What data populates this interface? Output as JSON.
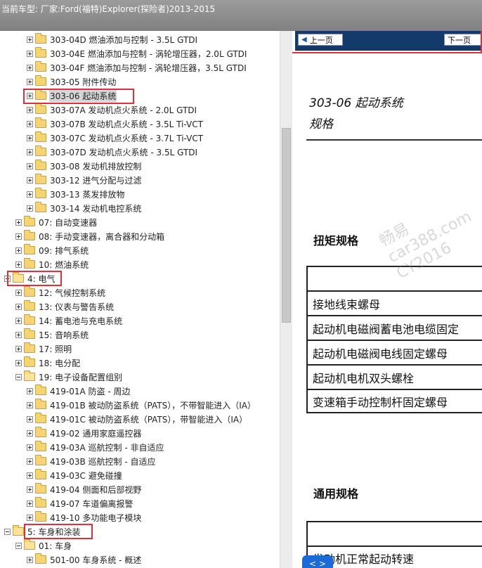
{
  "window": {
    "title": "当前车型:  厂家:Ford(福特)Explorer(探险者)2013-2015"
  },
  "tree": {
    "items": [
      {
        "label": "303-04D 燃油添加与控制 - 3.5L GTDI",
        "folder_open": false,
        "expand": "plus",
        "selected": false
      },
      {
        "label": "303-04E 燃油添加与控制 - 涡轮增压器，2.0L GTDI",
        "folder_open": false,
        "expand": "plus",
        "selected": false
      },
      {
        "label": "303-04F 燃油添加与控制 - 涡轮增压器，3.5L GTDI",
        "folder_open": false,
        "expand": "plus",
        "selected": false
      },
      {
        "label": "303-05 附件传动",
        "folder_open": false,
        "expand": "plus",
        "selected": false
      },
      {
        "label": "303-06 起动系统",
        "folder_open": false,
        "expand": "plus",
        "selected": true
      },
      {
        "label": "303-07A 发动机点火系统 - 2.0L GTDI",
        "folder_open": false,
        "expand": "plus",
        "selected": false
      },
      {
        "label": "303-07B 发动机点火系统 - 3.5L Ti-VCT",
        "folder_open": false,
        "expand": "plus",
        "selected": false
      },
      {
        "label": "303-07C 发动机点火系统 - 3.7L Ti-VCT",
        "folder_open": false,
        "expand": "plus",
        "selected": false
      },
      {
        "label": "303-07D 发动机点火系统 - 3.5L GTDI",
        "folder_open": false,
        "expand": "plus",
        "selected": false
      },
      {
        "label": "303-08 发动机排放控制",
        "folder_open": false,
        "expand": "plus",
        "selected": false
      },
      {
        "label": "303-12 进气分配与过滤",
        "folder_open": false,
        "expand": "plus",
        "selected": false
      },
      {
        "label": "303-13 蒸发排放物",
        "folder_open": false,
        "expand": "plus",
        "selected": false
      },
      {
        "label": "303-14 发动机电控系统",
        "folder_open": false,
        "expand": "plus",
        "selected": false
      },
      {
        "label": "07: 自动变速器",
        "folder_open": false,
        "expand": "plus",
        "selected": false
      },
      {
        "label": "08: 手动变速器，离合器和分动箱",
        "folder_open": false,
        "expand": "plus",
        "selected": false
      },
      {
        "label": "09: 排气系统",
        "folder_open": false,
        "expand": "plus",
        "selected": false
      },
      {
        "label": "10: 燃油系统",
        "folder_open": false,
        "expand": "plus",
        "selected": false
      },
      {
        "label": "4: 电气",
        "folder_open": true,
        "expand": "minus",
        "selected": false
      },
      {
        "label": "12: 气候控制系统",
        "folder_open": false,
        "expand": "plus",
        "selected": false
      },
      {
        "label": "13: 仪表与警告系统",
        "folder_open": false,
        "expand": "plus",
        "selected": false
      },
      {
        "label": "14: 蓄电池与充电系统",
        "folder_open": false,
        "expand": "plus",
        "selected": false
      },
      {
        "label": "15: 音响系统",
        "folder_open": false,
        "expand": "plus",
        "selected": false
      },
      {
        "label": "17: 照明",
        "folder_open": false,
        "expand": "plus",
        "selected": false
      },
      {
        "label": "18: 电分配",
        "folder_open": false,
        "expand": "plus",
        "selected": false
      },
      {
        "label": "19: 电子设备配置组别",
        "folder_open": true,
        "expand": "minus",
        "selected": false
      },
      {
        "label": "419-01A 防盗 - 周边",
        "folder_open": false,
        "expand": "plus",
        "selected": false
      },
      {
        "label": "419-01B 被动防盗系统（PATS），不带智能进入（IA）",
        "folder_open": false,
        "expand": "plus",
        "selected": false
      },
      {
        "label": "419-01C 被动防盗系统（PATS），带智能进入（IA）",
        "folder_open": false,
        "expand": "plus",
        "selected": false
      },
      {
        "label": "419-02 通用家庭遥控器",
        "folder_open": false,
        "expand": "plus",
        "selected": false
      },
      {
        "label": "419-03A 巡航控制 - 非自适应",
        "folder_open": false,
        "expand": "plus",
        "selected": false
      },
      {
        "label": "419-03B 巡航控制 - 自适应",
        "folder_open": false,
        "expand": "plus",
        "selected": false
      },
      {
        "label": "419-03C 避免碰撞",
        "folder_open": false,
        "expand": "plus",
        "selected": false
      },
      {
        "label": "419-04 侧面和后部视野",
        "folder_open": false,
        "expand": "plus",
        "selected": false
      },
      {
        "label": "419-07 车道偏离报警",
        "folder_open": false,
        "expand": "plus",
        "selected": false
      },
      {
        "label": "419-10 多功能电子模块",
        "folder_open": false,
        "expand": "plus",
        "selected": false
      },
      {
        "label": "5: 车身和涂装",
        "folder_open": true,
        "expand": "minus",
        "selected": false
      },
      {
        "label": "01: 车身",
        "folder_open": true,
        "expand": "minus",
        "selected": false
      },
      {
        "label": "501-00 车身系统 - 概述",
        "folder_open": false,
        "expand": "plus",
        "selected": false
      }
    ]
  },
  "doc": {
    "prev_label": "上一页",
    "next_label": "下一页",
    "title_line1": "303-06 起动系统",
    "title_line2": "规格",
    "torque_heading": "扭矩规格",
    "torque_rows": [
      "",
      "接地线束螺母",
      "起动机电磁阀蓄电池电缆固定",
      "起动机电磁阀电线固定螺母",
      "起动机电机双头螺栓",
      "变速箱手动控制杆固定螺母"
    ],
    "general_heading": "通用规格",
    "general_rows": [
      "",
      "发动机正常起动转速"
    ],
    "watermark": [
      "畅易",
      "car388.com",
      "CY2016"
    ],
    "float_label": "< >"
  },
  "colors": {
    "highlight_red": "#e0303a",
    "nav_bg": "#143a6b",
    "folder": "#f5d571"
  }
}
